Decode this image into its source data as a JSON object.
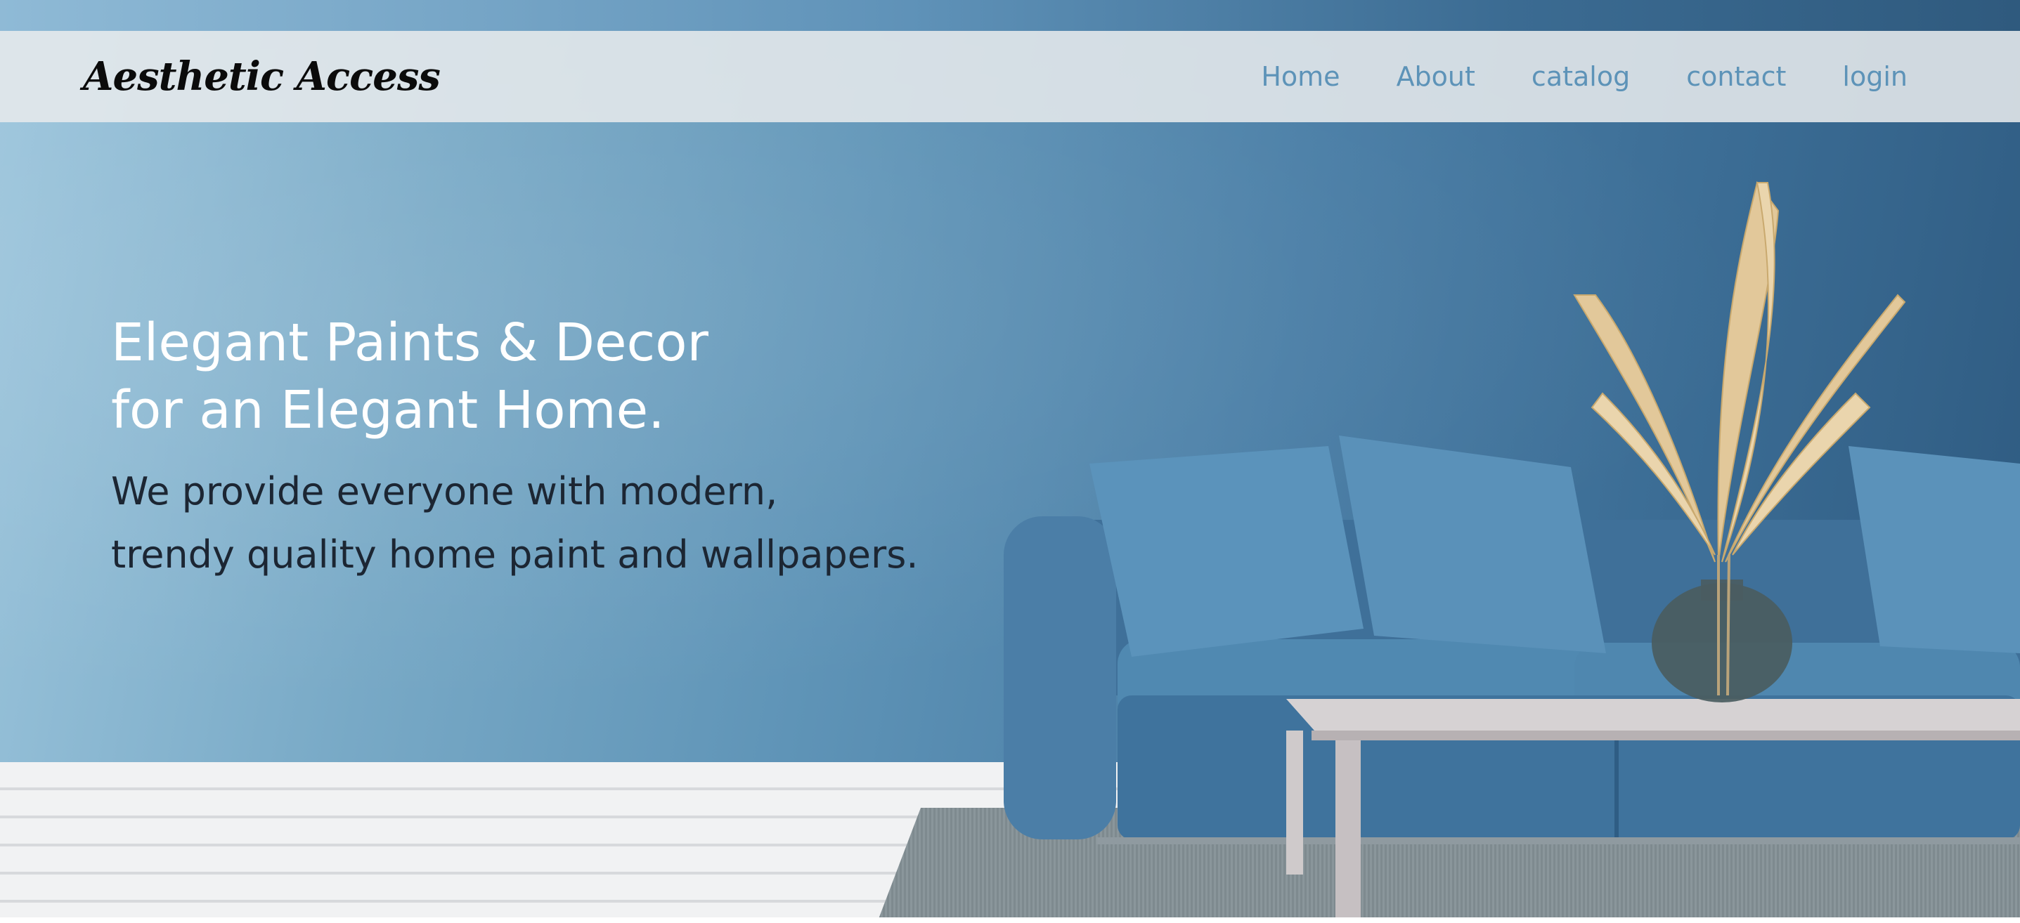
{
  "brand": {
    "name": "Aesthetic Access"
  },
  "nav": {
    "items": [
      {
        "label": "Home"
      },
      {
        "label": "About"
      },
      {
        "label": "catalog"
      },
      {
        "label": "contact"
      },
      {
        "label": "login"
      }
    ]
  },
  "hero": {
    "headline_line1": "Elegant Paints & Decor",
    "headline_line2": "for an Elegant Home.",
    "subtext_line1": "We provide everyone with modern,",
    "subtext_line2": "trendy quality home paint and wallpapers."
  },
  "colors": {
    "nav_link": "#5d93b8",
    "navbar_bg": "#e6e9ec",
    "wall_light": "#9cc5dc",
    "wall_dark": "#2e5a80",
    "sofa": "#4a7ea8",
    "pampas": "#e2c89a"
  }
}
